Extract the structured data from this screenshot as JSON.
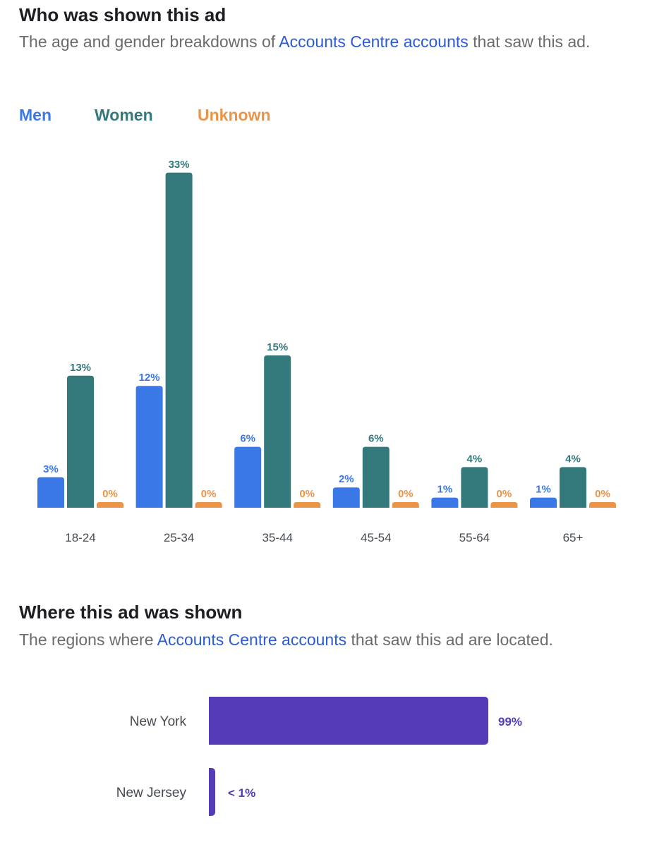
{
  "section1": {
    "title": "Who was shown this ad",
    "subtitle_pre": "The age and gender breakdowns of ",
    "subtitle_link": "Accounts Centre accounts",
    "subtitle_post": " that saw this ad."
  },
  "section2": {
    "title": "Where this ad was shown",
    "subtitle_pre": "The regions where ",
    "subtitle_link": "Accounts Centre accounts",
    "subtitle_post": " that saw this ad are located."
  },
  "chart_data": [
    {
      "type": "bar",
      "categories": [
        "18-24",
        "25-34",
        "35-44",
        "45-54",
        "55-64",
        "65+"
      ],
      "series": [
        {
          "name": "Men",
          "color": "#3b78e7",
          "values": [
            3,
            12,
            6,
            2,
            1,
            1
          ],
          "labels": [
            "3%",
            "12%",
            "6%",
            "2%",
            "1%",
            "1%"
          ]
        },
        {
          "name": "Women",
          "color": "#33797c",
          "values": [
            13,
            33,
            15,
            6,
            4,
            4
          ],
          "labels": [
            "13%",
            "33%",
            "15%",
            "6%",
            "4%",
            "4%"
          ]
        },
        {
          "name": "Unknown",
          "color": "#ea9448",
          "values": [
            0,
            0,
            0,
            0,
            0,
            0
          ],
          "labels": [
            "0%",
            "0%",
            "0%",
            "0%",
            "0%",
            "0%"
          ]
        }
      ],
      "legend": "top-left",
      "grid": false
    },
    {
      "type": "bar",
      "orientation": "horizontal",
      "categories": [
        "New York",
        "New Jersey"
      ],
      "values": [
        99,
        1
      ],
      "labels": [
        "99%",
        "< 1%"
      ],
      "color": "#553bb6"
    }
  ]
}
